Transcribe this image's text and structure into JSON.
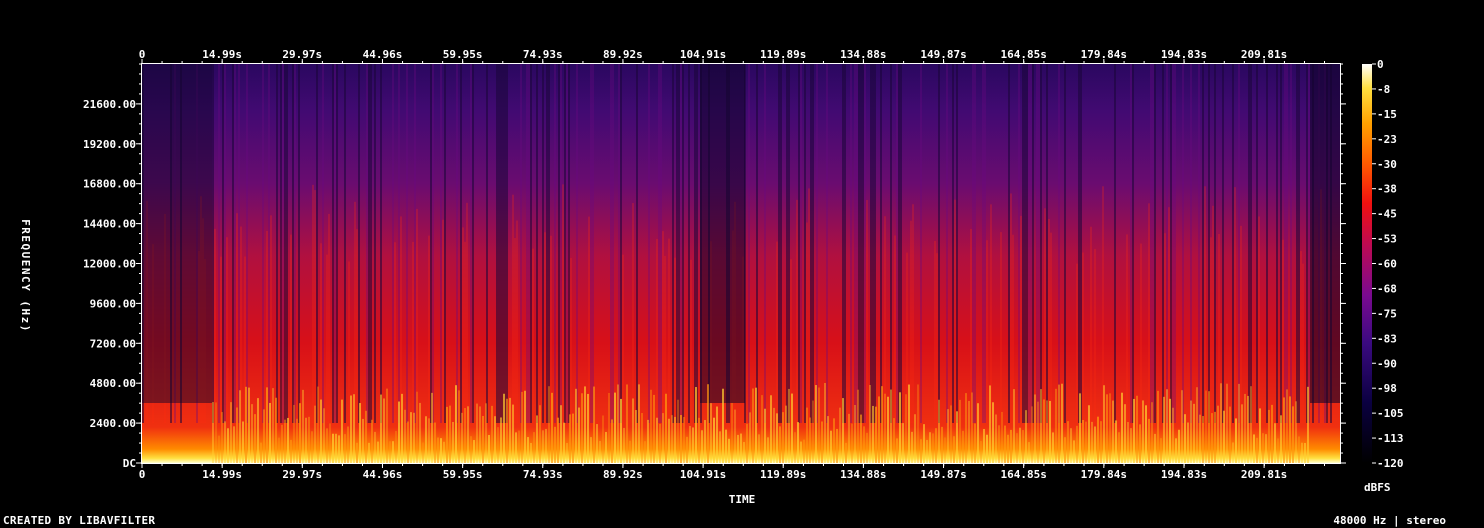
{
  "footer": {
    "credit": "CREATED BY LIBAVFILTER",
    "format": "48000 Hz | stereo"
  },
  "colors": {
    "background": "#000000",
    "spectrum_low": "#050010",
    "spectrum_purple": "#4a0a7a",
    "spectrum_red": "#e01010",
    "spectrum_orange": "#ff8a00",
    "spectrum_yellow": "#ffe040",
    "spectrum_white": "#ffffe8"
  },
  "chart_data": {
    "type": "heatmap",
    "xlabel": "TIME",
    "ylabel": "FREQUENCY (Hz)",
    "x_tick_labels": [
      "0",
      "14.99s",
      "29.97s",
      "44.96s",
      "59.95s",
      "74.93s",
      "89.92s",
      "104.91s",
      "119.89s",
      "134.88s",
      "149.87s",
      "164.85s",
      "179.84s",
      "194.83s",
      "209.81s"
    ],
    "x_tick_values": [
      0,
      14.99,
      29.97,
      44.96,
      59.95,
      74.93,
      89.92,
      104.91,
      119.89,
      134.88,
      149.87,
      164.85,
      179.84,
      194.83,
      209.81
    ],
    "xlim": [
      0,
      224
    ],
    "y_tick_labels": [
      "DC",
      "2400.00",
      "4800.00",
      "7200.00",
      "9600.00",
      "12000.00",
      "14400.00",
      "16800.00",
      "19200.00",
      "21600.00"
    ],
    "y_tick_values": [
      0,
      2400,
      4800,
      7200,
      9600,
      12000,
      14400,
      16800,
      19200,
      21600
    ],
    "ylim": [
      0,
      24000
    ],
    "colorbar": {
      "label": "dBFS",
      "tick_labels": [
        "0",
        "-8",
        "-15",
        "-23",
        "-30",
        "-38",
        "-45",
        "-53",
        "-60",
        "-68",
        "-75",
        "-83",
        "-90",
        "-98",
        "-105",
        "-113",
        "-120"
      ],
      "range": [
        -120,
        0
      ]
    }
  }
}
